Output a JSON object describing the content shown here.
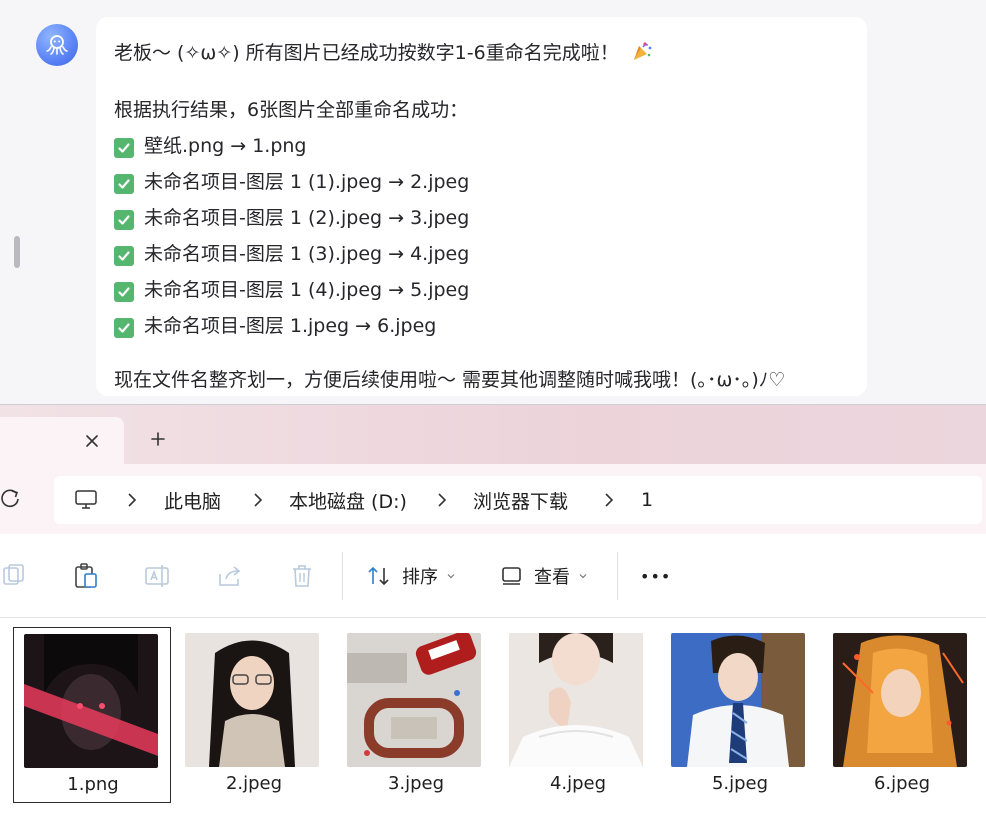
{
  "chat": {
    "message": {
      "greeting": "老板～ (✧ω✧) 所有图片已经成功按数字1-6重命名完成啦！",
      "result_intro": "根据执行结果，6张图片全部重命名成功：",
      "renames": [
        "壁纸.png → 1.png",
        "未命名项目-图层 1 (1).jpeg → 2.jpeg",
        "未命名项目-图层 1 (2).jpeg → 3.jpeg",
        "未命名项目-图层 1 (3).jpeg → 4.jpeg",
        "未命名项目-图层 1 (4).jpeg → 5.jpeg",
        "未命名项目-图层 1.jpeg → 6.jpeg"
      ],
      "closing": "现在文件名整齐划一，方便后续使用啦～ 需要其他调整随时喊我哦！(｡･ω･｡)ﾉ♡"
    },
    "icons": {
      "avatar": "octopus-avatar-icon",
      "check": "check-mark-icon",
      "party": "party-popper-icon"
    }
  },
  "explorer": {
    "tab": {
      "close_icon": "close-icon",
      "new_tab_icon": "plus-icon"
    },
    "address": {
      "root_icon": "computer-icon",
      "crumbs": [
        "此电脑",
        "本地磁盘 (D:)",
        "浏览器下载",
        "1"
      ]
    },
    "toolbar": {
      "sort_label": "排序",
      "view_label": "查看",
      "more_label": "•••"
    },
    "files": [
      {
        "name": "1.png",
        "selected": true
      },
      {
        "name": "2.jpeg"
      },
      {
        "name": "3.jpeg"
      },
      {
        "name": "4.jpeg"
      },
      {
        "name": "5.jpeg"
      },
      {
        "name": "6.jpeg"
      }
    ]
  },
  "colors": {
    "accent": "#5a83f5",
    "check_green": "#55b66f",
    "tabbar_pink": "#ecd3da"
  }
}
